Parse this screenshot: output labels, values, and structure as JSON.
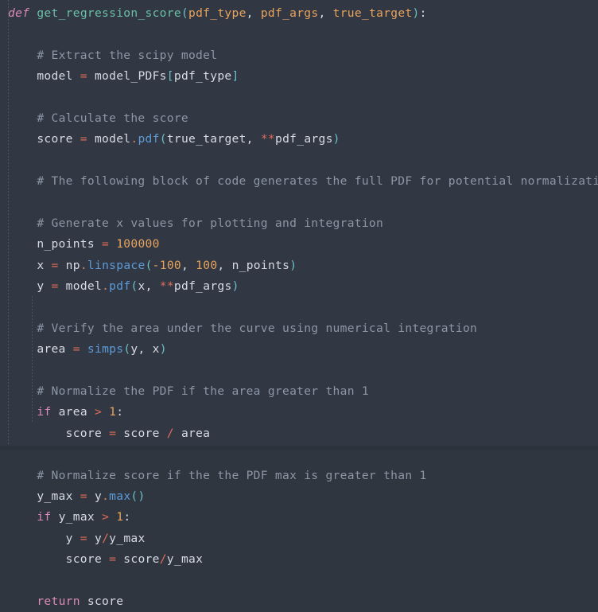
{
  "editor": {
    "name": "code-editor",
    "language": "python",
    "theme": "dark-slate",
    "background_color": "#313743",
    "colors": {
      "plain": "#d6dbe3",
      "keyword": "#d98ab8",
      "function_name": "#6bbfa7",
      "method": "#5c9bd6",
      "parameter": "#e8a45c",
      "number": "#e8a45c",
      "operator": "#e06c5a",
      "punctuation": "#6bbfc4",
      "comment": "#8d96a5",
      "indent_guide": "#4b525f"
    }
  },
  "code": {
    "lines": [
      {
        "id": 1,
        "text": "def get_regression_score(pdf_type, pdf_args, true_target):",
        "tokens": [
          {
            "c": "t-kw-def",
            "v": "def"
          },
          {
            "c": "t-plain",
            "v": " "
          },
          {
            "c": "t-fnname",
            "v": "get_regression_score"
          },
          {
            "c": "t-punct",
            "v": "("
          },
          {
            "c": "t-param",
            "v": "pdf_type"
          },
          {
            "c": "t-plain",
            "v": ", "
          },
          {
            "c": "t-param",
            "v": "pdf_args"
          },
          {
            "c": "t-plain",
            "v": ", "
          },
          {
            "c": "t-param",
            "v": "true_target"
          },
          {
            "c": "t-punct",
            "v": ")"
          },
          {
            "c": "t-plain",
            "v": ":"
          }
        ]
      },
      {
        "id": 2,
        "text": "",
        "tokens": []
      },
      {
        "id": 3,
        "text": "    # Extract the scipy model",
        "tokens": [
          {
            "c": "t-plain",
            "v": "    "
          },
          {
            "c": "t-comment",
            "v": "# Extract the scipy model"
          }
        ]
      },
      {
        "id": 4,
        "text": "    model = model_PDFs[pdf_type]",
        "tokens": [
          {
            "c": "t-plain",
            "v": "    model "
          },
          {
            "c": "t-op",
            "v": "="
          },
          {
            "c": "t-plain",
            "v": " model_PDFs"
          },
          {
            "c": "t-punct",
            "v": "["
          },
          {
            "c": "t-plain",
            "v": "pdf_type"
          },
          {
            "c": "t-punct",
            "v": "]"
          }
        ]
      },
      {
        "id": 5,
        "text": "",
        "tokens": []
      },
      {
        "id": 6,
        "text": "    # Calculate the score",
        "tokens": [
          {
            "c": "t-plain",
            "v": "    "
          },
          {
            "c": "t-comment",
            "v": "# Calculate the score"
          }
        ]
      },
      {
        "id": 7,
        "text": "    score = model.pdf(true_target, **pdf_args)",
        "tokens": [
          {
            "c": "t-plain",
            "v": "    score "
          },
          {
            "c": "t-op",
            "v": "="
          },
          {
            "c": "t-plain",
            "v": " model"
          },
          {
            "c": "t-dot",
            "v": "."
          },
          {
            "c": "t-method",
            "v": "pdf"
          },
          {
            "c": "t-punct",
            "v": "("
          },
          {
            "c": "t-plain",
            "v": "true_target, "
          },
          {
            "c": "t-op",
            "v": "**"
          },
          {
            "c": "t-plain",
            "v": "pdf_args"
          },
          {
            "c": "t-punct",
            "v": ")"
          }
        ]
      },
      {
        "id": 8,
        "text": "",
        "tokens": []
      },
      {
        "id": 9,
        "text": "    # The following block of code generates the full PDF for potential normalization",
        "tokens": [
          {
            "c": "t-plain",
            "v": "    "
          },
          {
            "c": "t-comment",
            "v": "# The following block of code generates the full PDF for potential normalization"
          }
        ]
      },
      {
        "id": 10,
        "text": "",
        "tokens": []
      },
      {
        "id": 11,
        "text": "    # Generate x values for plotting and integration",
        "tokens": [
          {
            "c": "t-plain",
            "v": "    "
          },
          {
            "c": "t-comment",
            "v": "# Generate x values for plotting and integration"
          }
        ]
      },
      {
        "id": 12,
        "text": "    n_points = 100000",
        "tokens": [
          {
            "c": "t-plain",
            "v": "    n_points "
          },
          {
            "c": "t-op",
            "v": "="
          },
          {
            "c": "t-plain",
            "v": " "
          },
          {
            "c": "t-num",
            "v": "100000"
          }
        ]
      },
      {
        "id": 13,
        "text": "    x = np.linspace(-100, 100, n_points)",
        "tokens": [
          {
            "c": "t-plain",
            "v": "    x "
          },
          {
            "c": "t-op",
            "v": "="
          },
          {
            "c": "t-plain",
            "v": " np"
          },
          {
            "c": "t-dot",
            "v": "."
          },
          {
            "c": "t-method",
            "v": "linspace"
          },
          {
            "c": "t-punct",
            "v": "("
          },
          {
            "c": "t-num",
            "v": "-100"
          },
          {
            "c": "t-plain",
            "v": ", "
          },
          {
            "c": "t-num",
            "v": "100"
          },
          {
            "c": "t-plain",
            "v": ", n_points"
          },
          {
            "c": "t-punct",
            "v": ")"
          }
        ]
      },
      {
        "id": 14,
        "text": "    y = model.pdf(x, **pdf_args)",
        "tokens": [
          {
            "c": "t-plain",
            "v": "    y "
          },
          {
            "c": "t-op",
            "v": "="
          },
          {
            "c": "t-plain",
            "v": " model"
          },
          {
            "c": "t-dot",
            "v": "."
          },
          {
            "c": "t-method",
            "v": "pdf"
          },
          {
            "c": "t-punct",
            "v": "("
          },
          {
            "c": "t-plain",
            "v": "x, "
          },
          {
            "c": "t-op",
            "v": "**"
          },
          {
            "c": "t-plain",
            "v": "pdf_args"
          },
          {
            "c": "t-punct",
            "v": ")"
          }
        ]
      },
      {
        "id": 15,
        "text": "",
        "tokens": []
      },
      {
        "id": 16,
        "text": "    # Verify the area under the curve using numerical integration",
        "tokens": [
          {
            "c": "t-plain",
            "v": "    "
          },
          {
            "c": "t-comment",
            "v": "# Verify the area under the curve using numerical integration"
          }
        ]
      },
      {
        "id": 17,
        "text": "    area = simps(y, x)",
        "tokens": [
          {
            "c": "t-plain",
            "v": "    area "
          },
          {
            "c": "t-op",
            "v": "="
          },
          {
            "c": "t-plain",
            "v": " "
          },
          {
            "c": "t-method",
            "v": "simps"
          },
          {
            "c": "t-punct",
            "v": "("
          },
          {
            "c": "t-plain",
            "v": "y, x"
          },
          {
            "c": "t-punct",
            "v": ")"
          }
        ]
      },
      {
        "id": 18,
        "text": "",
        "tokens": []
      },
      {
        "id": 19,
        "text": "    # Normalize the PDF if the area greater than 1",
        "tokens": [
          {
            "c": "t-plain",
            "v": "    "
          },
          {
            "c": "t-comment",
            "v": "# Normalize the PDF if the area greater than 1"
          }
        ]
      },
      {
        "id": 20,
        "text": "    if area > 1:",
        "tokens": [
          {
            "c": "t-plain",
            "v": "    "
          },
          {
            "c": "t-kw",
            "v": "if"
          },
          {
            "c": "t-plain",
            "v": " area "
          },
          {
            "c": "t-op",
            "v": ">"
          },
          {
            "c": "t-plain",
            "v": " "
          },
          {
            "c": "t-num",
            "v": "1"
          },
          {
            "c": "t-plain",
            "v": ":"
          }
        ]
      },
      {
        "id": 21,
        "text": "        score = score / area",
        "tokens": [
          {
            "c": "t-plain",
            "v": "        score "
          },
          {
            "c": "t-op",
            "v": "="
          },
          {
            "c": "t-plain",
            "v": " score "
          },
          {
            "c": "t-op",
            "v": "/"
          },
          {
            "c": "t-plain",
            "v": " area"
          }
        ]
      },
      {
        "id": 22,
        "text": "",
        "tokens": []
      },
      {
        "id": 23,
        "text": "    # Normalize score if the the PDF max is greater than 1",
        "tokens": [
          {
            "c": "t-plain",
            "v": "    "
          },
          {
            "c": "t-comment",
            "v": "# Normalize score if the the PDF max is greater than 1"
          }
        ]
      },
      {
        "id": 24,
        "text": "    y_max = y.max()",
        "tokens": [
          {
            "c": "t-plain",
            "v": "    y_max "
          },
          {
            "c": "t-op",
            "v": "="
          },
          {
            "c": "t-plain",
            "v": " y"
          },
          {
            "c": "t-dot",
            "v": "."
          },
          {
            "c": "t-method",
            "v": "max"
          },
          {
            "c": "t-punct",
            "v": "()"
          }
        ]
      },
      {
        "id": 25,
        "text": "    if y_max > 1:",
        "tokens": [
          {
            "c": "t-plain",
            "v": "    "
          },
          {
            "c": "t-kw",
            "v": "if"
          },
          {
            "c": "t-plain",
            "v": " y_max "
          },
          {
            "c": "t-op",
            "v": ">"
          },
          {
            "c": "t-plain",
            "v": " "
          },
          {
            "c": "t-num",
            "v": "1"
          },
          {
            "c": "t-plain",
            "v": ":"
          }
        ]
      },
      {
        "id": 26,
        "text": "        y = y/y_max",
        "tokens": [
          {
            "c": "t-plain",
            "v": "        y "
          },
          {
            "c": "t-op",
            "v": "="
          },
          {
            "c": "t-plain",
            "v": " y"
          },
          {
            "c": "t-op",
            "v": "/"
          },
          {
            "c": "t-plain",
            "v": "y_max"
          }
        ]
      },
      {
        "id": 27,
        "text": "        score = score/y_max",
        "tokens": [
          {
            "c": "t-plain",
            "v": "        score "
          },
          {
            "c": "t-op",
            "v": "="
          },
          {
            "c": "t-plain",
            "v": " score"
          },
          {
            "c": "t-op",
            "v": "/"
          },
          {
            "c": "t-plain",
            "v": "y_max"
          }
        ]
      },
      {
        "id": 28,
        "text": "",
        "tokens": []
      },
      {
        "id": 29,
        "text": "    return score",
        "tokens": [
          {
            "c": "t-plain",
            "v": "    "
          },
          {
            "c": "t-kw",
            "v": "return"
          },
          {
            "c": "t-plain",
            "v": " score"
          }
        ]
      }
    ]
  }
}
